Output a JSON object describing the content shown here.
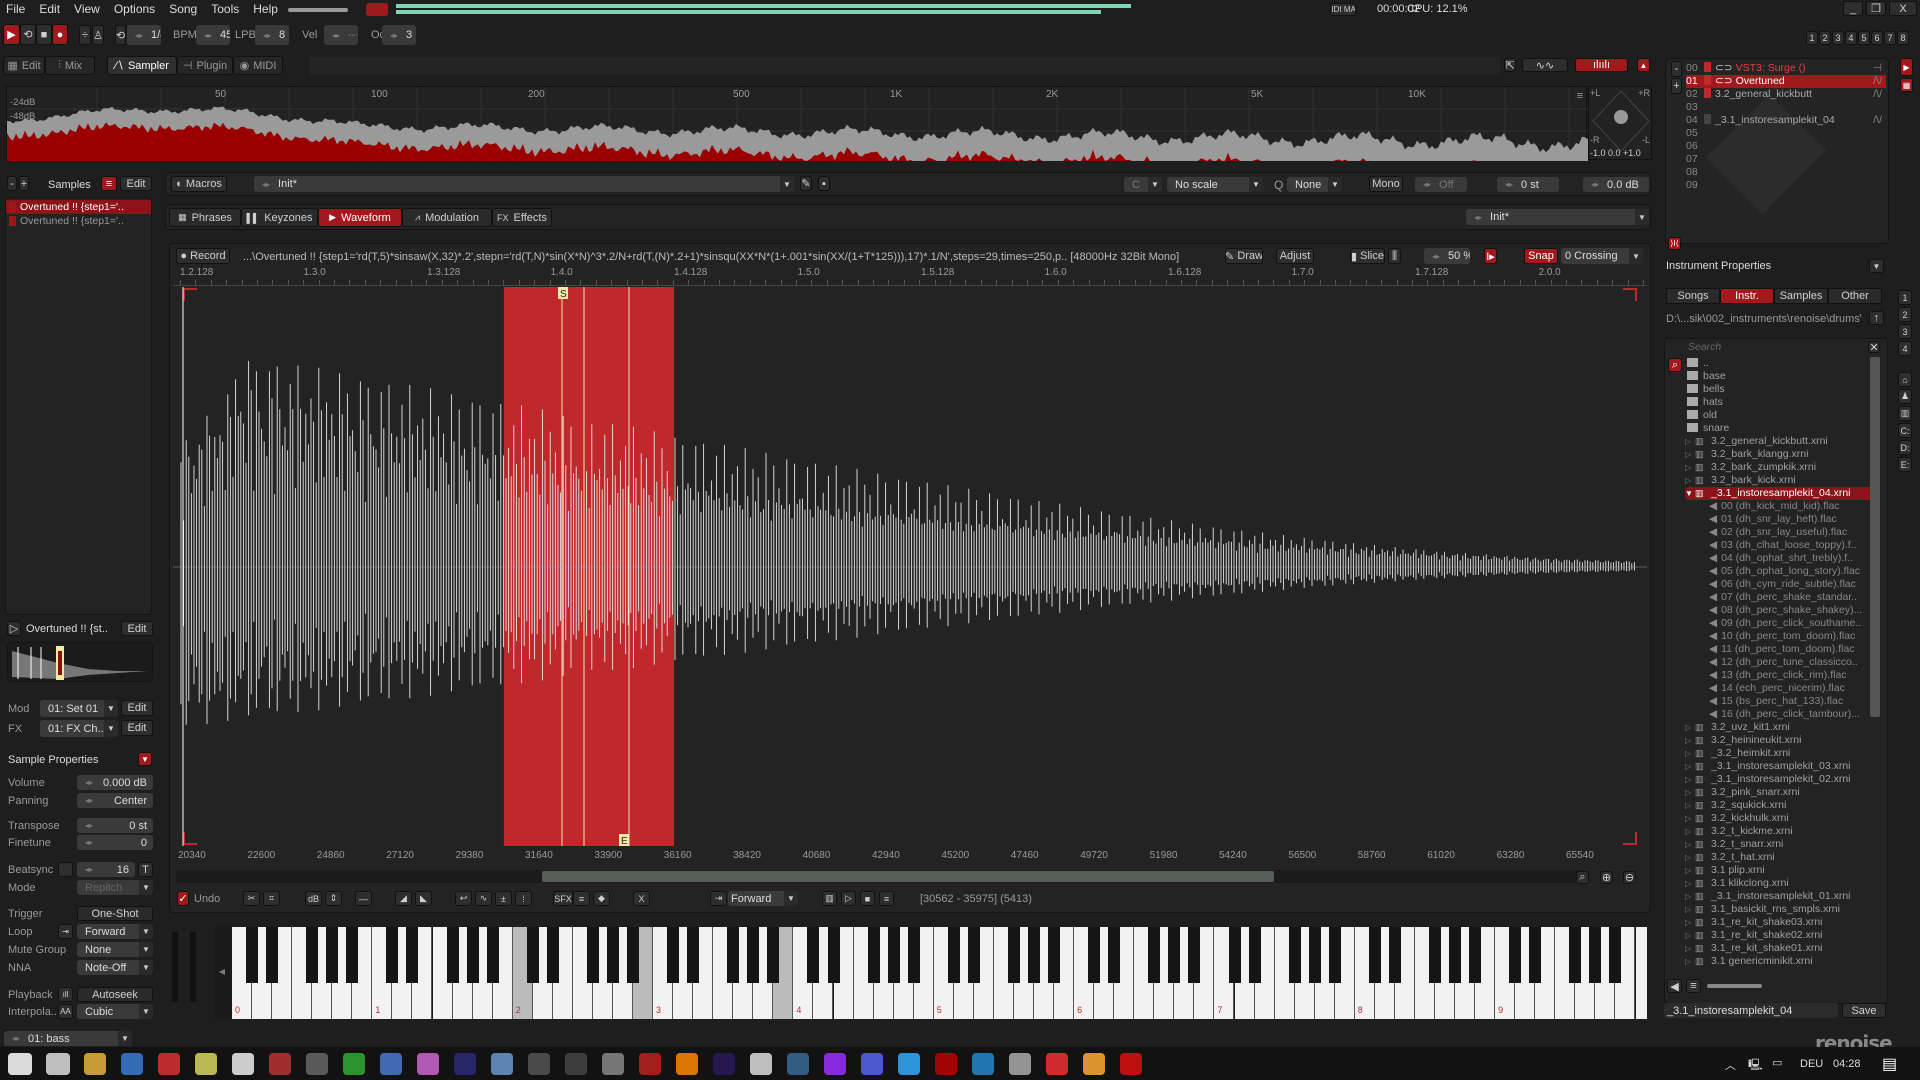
{
  "menu": [
    "File",
    "Edit",
    "View",
    "Options",
    "Song",
    "Tools",
    "Help"
  ],
  "transport": {
    "pattern_step": "1/4",
    "bpm_label": "BPM",
    "bpm": "45",
    "lpb_label": "LPB",
    "lpb": "8",
    "vel_label": "Vel",
    "vel": "--",
    "oct_label": "Oct",
    "oct": "3"
  },
  "status": {
    "midi_map": "MIDI MAP",
    "time": "00:00:02",
    "cpu": "CPU: 12.1%",
    "tracks": [
      "1",
      "2",
      "3",
      "4",
      "5",
      "6",
      "7",
      "8"
    ]
  },
  "views": [
    {
      "label": "Edit",
      "icon": "grid-icon"
    },
    {
      "label": "Mix",
      "icon": "mixer-icon"
    },
    {
      "label": "Sampler",
      "icon": "waveform-icon",
      "active": true
    },
    {
      "label": "Plugin",
      "icon": "plug-icon"
    },
    {
      "label": "MIDI",
      "icon": "midi-icon"
    }
  ],
  "spectrum": {
    "db_labels": [
      "-24dB",
      "-48dB"
    ],
    "freq_labels": [
      "50",
      "100",
      "200",
      "500",
      "1K",
      "2K",
      "5K",
      "10K"
    ],
    "scope": {
      "tl": "+L",
      "tr": "+R",
      "bl": "-R",
      "br": "-L",
      "scale": "-1.0 0.0 +1.0"
    },
    "colors": {
      "peak": "#9a9a9a",
      "rms": "#9a0000"
    }
  },
  "instruments": [
    {
      "num": "00",
      "name": "VST3: Surge ()",
      "type": "plugin"
    },
    {
      "num": "01",
      "name": "Overtuned",
      "selected": true
    },
    {
      "num": "02",
      "name": "3.2_general_kickbutt"
    },
    {
      "num": "03",
      "name": ""
    },
    {
      "num": "04",
      "name": "_3.1_instoresamplekit_04"
    },
    {
      "num": "05",
      "name": ""
    },
    {
      "num": "06",
      "name": ""
    },
    {
      "num": "07",
      "name": ""
    },
    {
      "num": "08",
      "name": ""
    },
    {
      "num": "09",
      "name": ""
    }
  ],
  "samples": {
    "title": "Samples",
    "edit": "Edit",
    "items": [
      "Overtuned !! {step1='..",
      "Overtuned !! {step1='.."
    ]
  },
  "macros": {
    "label": "Macros",
    "preset": "Init*",
    "key": "C",
    "scale": "No scale",
    "quant": "None",
    "mono": "Mono",
    "glide": "Off",
    "transpose": "0 st",
    "volume": "0.0 dB"
  },
  "editor_tabs": [
    "Phrases",
    "Keyzones",
    "Waveform",
    "Modulation",
    "Effects"
  ],
  "editor_tab_active": "Waveform",
  "editor_preset": "Init*",
  "waveform": {
    "record": "Record",
    "info": "...\\Overtuned !! {step1='rd(T,5)*sinsaw(X,32)*.2',stepn='rd(T,N)*sin(X*N)^3*.2/N+rd(T,(N)*.2+1)*sinsqu(XX*N*(1+.001*sin(XX/(1+T*125))),17)*.1/N',steps=29,times=250,p.. [48000Hz 32Bit Mono]",
    "draw": "Draw",
    "adjust": "Adjust",
    "slice": "Slice",
    "slice_pct": "50 %",
    "snap": "Snap",
    "snap_mode": "0 Crossing",
    "beat_ruler": [
      "1.2.128",
      "1.3.0",
      "1.3.128",
      "1.4.0",
      "1.4.128",
      "1.5.0",
      "1.5.128",
      "1.6.0",
      "1.6.128",
      "1.7.0",
      "1.7.128",
      "2.0.0"
    ],
    "sample_ruler": [
      "20340",
      "22600",
      "24860",
      "27120",
      "29380",
      "31640",
      "33900",
      "36160",
      "38420",
      "40680",
      "42940",
      "45200",
      "47460",
      "49720",
      "51980",
      "54240",
      "56500",
      "58760",
      "61020",
      "63280",
      "65540"
    ],
    "selection": {
      "start": 30562,
      "end": 35975,
      "length": 5413
    },
    "markers": {
      "start": "S",
      "end": "E"
    },
    "selection_color": "#c0282c"
  },
  "toolbar": {
    "undo": "Undo",
    "loop_mode": "Forward",
    "selection_text": "[30562 - 35975] (5413)"
  },
  "keyboard": {
    "octaves": [
      "0",
      "1",
      "2",
      "3",
      "4",
      "5",
      "6",
      "7",
      "8",
      "9"
    ]
  },
  "sample_panel": {
    "name": "Overtuned !! {st..",
    "edit": "Edit",
    "mod_label": "Mod",
    "mod": "01: Set 01",
    "fx_label": "FX",
    "fx": "01: FX Ch..",
    "title": "Sample Properties",
    "props": [
      {
        "label": "Volume",
        "value": "0.000 dB"
      },
      {
        "label": "Panning",
        "value": "Center"
      },
      {
        "label": "Transpose",
        "value": "0 st"
      },
      {
        "label": "Finetune",
        "value": "0"
      },
      {
        "label": "Beatsync",
        "value": "16",
        "extra": "T"
      },
      {
        "label": "Mode",
        "value": "Repitch"
      },
      {
        "label": "Trigger",
        "value": "One-Shot"
      },
      {
        "label": "Loop",
        "value": "Forward"
      },
      {
        "label": "Mute Group",
        "value": "None"
      },
      {
        "label": "NNA",
        "value": "Note-Off"
      },
      {
        "label": "Playback",
        "value": "Autoseek"
      },
      {
        "label": "Interpola..",
        "value": "Cubic"
      }
    ]
  },
  "track_select": "01: bass",
  "browser": {
    "title": "Instrument Properties",
    "tabs": [
      "Songs",
      "Instr.",
      "Samples",
      "Other"
    ],
    "active_tab": "Instr.",
    "path": "D:\\...sik\\002_instruments\\renoise\\drums\\",
    "search_placeholder": "Search",
    "folders": [
      "..",
      "base",
      "bells",
      "hats",
      "old",
      "snare"
    ],
    "files_before": [
      "3.2_general_kickbutt.xrni",
      "3.2_bark_klangg.xrni",
      "3.2_bark_zumpkik.xrni",
      "3.2_bark_kick.xrni"
    ],
    "open_file": "_3.1_instoresamplekit_04.xrni",
    "open_children": [
      "00 (dh_kick_mid_kid).flac",
      "01 (dh_snr_lay_heft).flac",
      "02 (dh_snr_lay_useful).flac",
      "03 (dh_clhat_loose_toppy).f..",
      "04 (dh_ophat_shrt_trebly).f..",
      "05 (dh_ophat_long_story).flac",
      "06 (dh_cym_ride_subtle).flac",
      "07 (dh_perc_shake_standar..",
      "08 (dh_perc_shake_shakey)...",
      "09 (dh_perc_click_southame..",
      "10 (dh_perc_tom_doom).flac",
      "11 (dh_perc_tom_doom).flac",
      "12 (dh_perc_tune_classicco..",
      "13 (dh_perc_click_rim).flac",
      "14 (ech_perc_nicerim).flac",
      "15 (bs_perc_hat_133).flac",
      "16 (dh_perc_click_tambour)..."
    ],
    "files_after": [
      "3.2_uvz_kit1.xrni",
      "3.2_heinineukit.xrni",
      "_3.2_heimkit.xrni",
      "_3.1_instoresamplekit_03.xrni",
      "_3.1_instoresamplekit_02.xrni",
      "3.2_pink_snarr.xrni",
      "3.2_squkick.xrni",
      "3.2_kickhulk.xrni",
      "3.2_t_kickme.xrni",
      "3.2_t_snarr.xrni",
      "3.2_t_hat.xrni",
      "3.1 plip.xrni",
      "3.1 klikclong.xrni",
      "_3.1_instoresamplekit_01.xrni",
      "3.1_basickit_rns_smpls.xrni",
      "3.1_re_kit_shake03.xrni",
      "3.1_re_kit_shake02.xrni",
      "3.1_re_kit_shake01.xrni",
      "3.1 genericminikit.xrni"
    ],
    "save_name": "_3.1_instoresamplekit_04",
    "save": "Save"
  },
  "right_strip": {
    "numbers": [
      "1",
      "2",
      "3",
      "4"
    ],
    "drives": [
      "C:",
      "D:",
      "E:"
    ]
  },
  "logo": "renoise",
  "taskbar": {
    "lang": "DEU",
    "clock": "04:28"
  },
  "accent": "#a3181c"
}
